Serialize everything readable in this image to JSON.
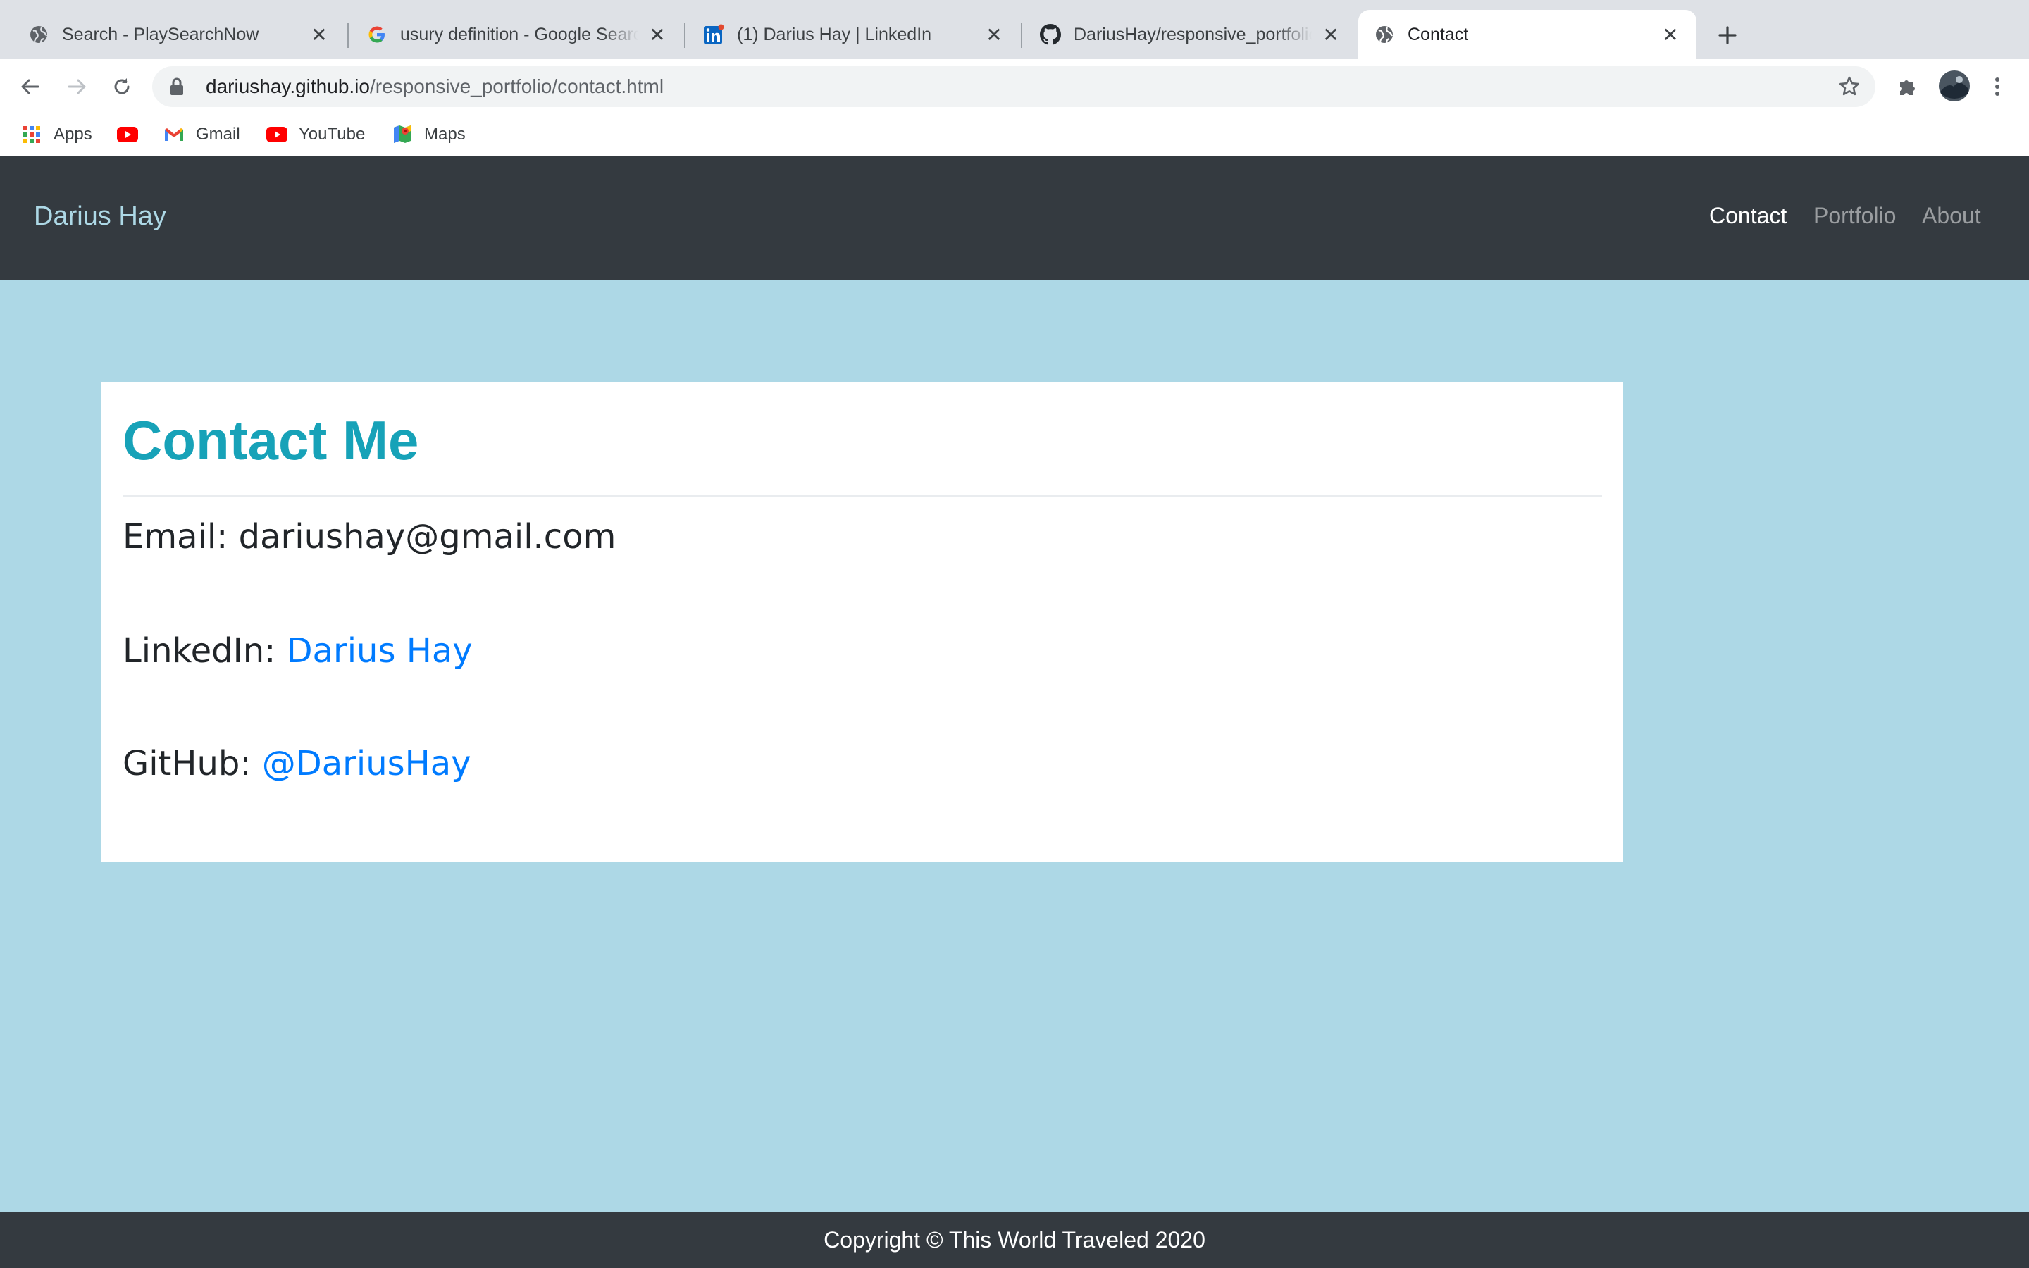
{
  "browser": {
    "tabs": [
      {
        "title": "Search - PlaySearchNow",
        "icon": "globe-icon",
        "active": false
      },
      {
        "title": "usury definition - Google Search",
        "icon": "google-icon",
        "active": false
      },
      {
        "title": "(1) Darius Hay | LinkedIn",
        "icon": "linkedin-icon",
        "active": false
      },
      {
        "title": "DariusHay/responsive_portfolio",
        "icon": "github-icon",
        "active": false
      },
      {
        "title": "Contact",
        "icon": "globe-icon",
        "active": true
      }
    ],
    "address": {
      "host": "dariushay.github.io",
      "path": "/responsive_portfolio/contact.html"
    },
    "bookmarks": [
      {
        "label": "Apps",
        "icon": "apps-grid-icon"
      },
      {
        "label": "",
        "icon": "youtube-icon"
      },
      {
        "label": "Gmail",
        "icon": "gmail-icon"
      },
      {
        "label": "YouTube",
        "icon": "youtube-icon"
      },
      {
        "label": "Maps",
        "icon": "maps-icon"
      }
    ]
  },
  "site": {
    "brand": "Darius Hay",
    "nav": [
      {
        "label": "Contact",
        "active": true
      },
      {
        "label": "Portfolio",
        "active": false
      },
      {
        "label": "About",
        "active": false
      }
    ],
    "contact": {
      "heading": "Contact Me",
      "email_label": "Email: ",
      "email_value": "dariushay@gmail.com",
      "linkedin_label": "LinkedIn: ",
      "linkedin_link": "Darius Hay",
      "github_label": "GitHub: ",
      "github_link": "@DariusHay"
    },
    "footer": "Copyright © This World Traveled 2020"
  },
  "colors": {
    "page_background": "#add8e6",
    "navbar": "#343a40",
    "heading": "#17a2b8",
    "link": "#007bff"
  }
}
